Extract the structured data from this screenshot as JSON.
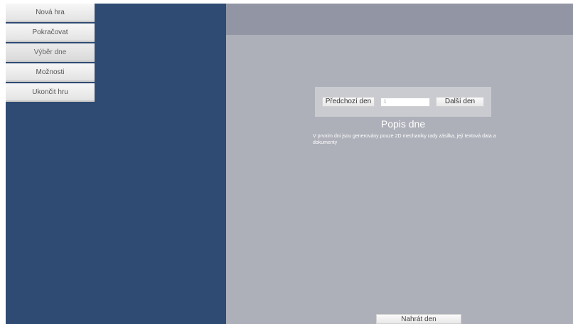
{
  "menu": {
    "items": [
      {
        "label": "Nová hra"
      },
      {
        "label": "Pokračovat"
      },
      {
        "label": "Výběr dne"
      },
      {
        "label": "Možnosti"
      },
      {
        "label": "Ukončit hru"
      }
    ],
    "selected": "Výběr dne"
  },
  "day_selector": {
    "prev_label": "Předchozí den",
    "input_value": "1",
    "next_label": "Další den"
  },
  "day": {
    "title": "Popis dne",
    "description": "V prvním dni jsou generovány pouze 2D mechaniky rady zásilka, její textová data a dokumenty"
  },
  "footer": {
    "load_label": "Nahrát den"
  },
  "colors": {
    "left_panel": "#2f4b74",
    "right_panel": "#adb0b9",
    "right_header": "#9296a4",
    "nav_box": "#c9cbd1"
  }
}
